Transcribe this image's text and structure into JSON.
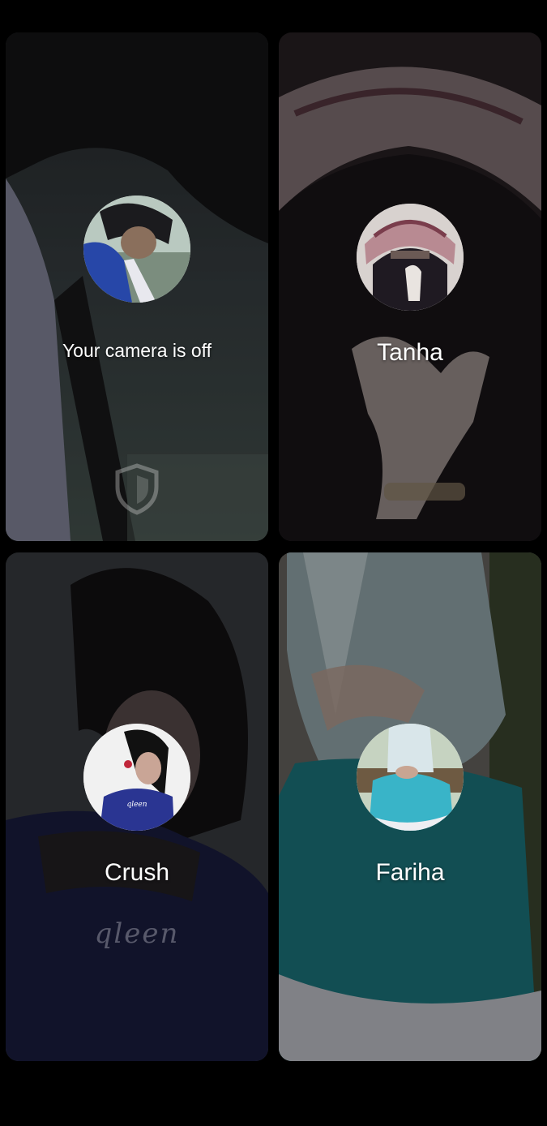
{
  "tiles": [
    {
      "id": "self",
      "label": "Your camera is off",
      "icon": "shield-icon"
    },
    {
      "id": "tanha",
      "label": "Tanha"
    },
    {
      "id": "crush",
      "label": "Crush",
      "watermark": "qleen"
    },
    {
      "id": "fariha",
      "label": "Fariha"
    }
  ],
  "colors": {
    "background": "#000000",
    "text": "#ffffff"
  }
}
